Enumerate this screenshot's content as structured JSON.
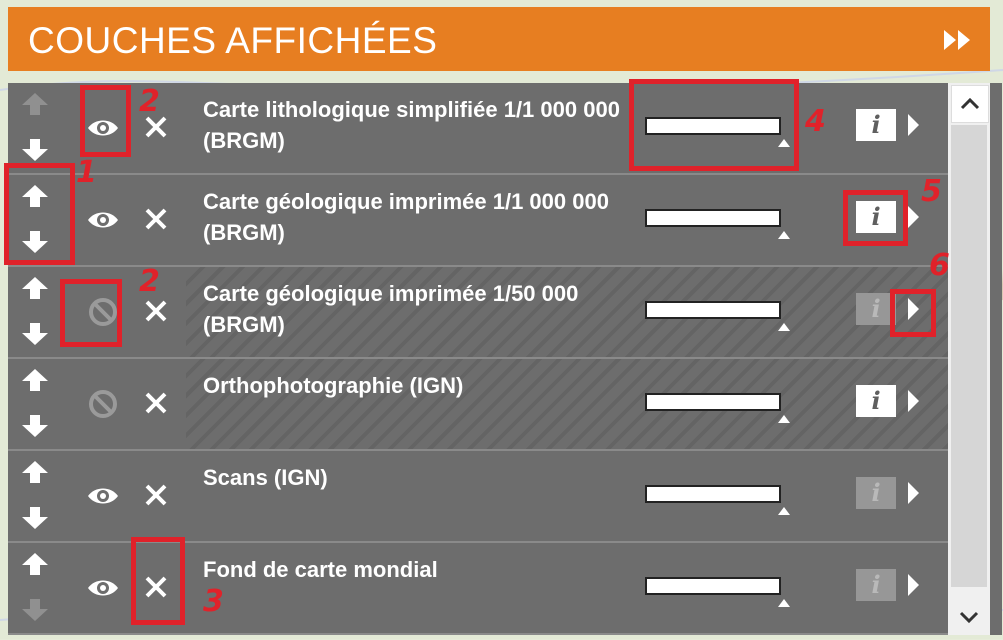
{
  "header": {
    "title": "COUCHES AFFICHÉES",
    "collapse_icon": "double-chevron-right-icon",
    "bg_color": "#e77e21"
  },
  "layers": [
    {
      "name": "Carte lithologique simplifiée 1/1 000 000 (BRGM)",
      "visible": true,
      "in_range": true,
      "up_enabled": false,
      "down_enabled": true,
      "info_enabled": true
    },
    {
      "name": "Carte géologique imprimée 1/1 000 000 (BRGM)",
      "visible": true,
      "in_range": true,
      "up_enabled": true,
      "down_enabled": true,
      "info_enabled": true
    },
    {
      "name": "Carte géologique imprimée 1/50 000 (BRGM)",
      "visible": false,
      "in_range": false,
      "up_enabled": true,
      "down_enabled": true,
      "info_enabled": false
    },
    {
      "name": "Orthophotographie (IGN)",
      "visible": false,
      "in_range": false,
      "up_enabled": true,
      "down_enabled": true,
      "info_enabled": true
    },
    {
      "name": "Scans (IGN)",
      "visible": true,
      "in_range": true,
      "up_enabled": true,
      "down_enabled": true,
      "info_enabled": false
    },
    {
      "name": "Fond de carte mondial",
      "visible": true,
      "in_range": true,
      "up_enabled": true,
      "down_enabled": false,
      "info_enabled": false
    }
  ],
  "info_label": "i",
  "annotations": [
    "1",
    "2",
    "2",
    "3",
    "4",
    "5",
    "6"
  ],
  "annotation_color": "#e0222a"
}
